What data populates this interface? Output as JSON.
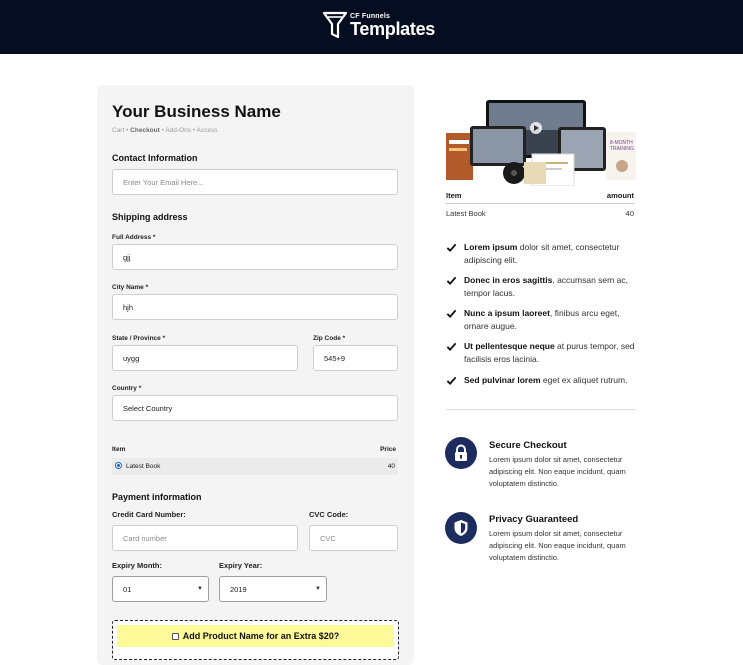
{
  "header": {
    "logo_small": "CF Funnels",
    "logo_big": "Templates"
  },
  "checkout": {
    "business_name": "Your Business Name",
    "breadcrumb": {
      "cart": "Cart",
      "sep1": " • ",
      "checkout": "Checkout",
      "sep2": " • ",
      "addons": "Add-Ons",
      "sep3": " • ",
      "access": "Access"
    },
    "contact_heading": "Contact Information",
    "email_placeholder": "Enter Your Email Here...",
    "shipping_heading": "Shipping address",
    "full_address_label": "Full Address *",
    "full_address_value": "gjj",
    "city_label": "City Name *",
    "city_value": "hjh",
    "state_label": "State / Province *",
    "state_value": "uygg",
    "zip_label": "Zip Code *",
    "zip_value": "545+9",
    "country_label": "Country *",
    "country_selected": "Select Country",
    "items_table": {
      "col_item": "Item",
      "col_price": "Price",
      "rows": [
        {
          "name": "Latest Book",
          "price": "40",
          "selected": true
        }
      ]
    },
    "payment_heading": "Payment information",
    "cc_label": "Credit Card Number:",
    "cc_placeholder": "Card number",
    "cvc_label": "CVC Code:",
    "cvc_placeholder": "CVC",
    "exp_month_label": "Expiry Month:",
    "exp_month_value": "01",
    "exp_year_label": "Expiry Year:",
    "exp_year_value": "2019",
    "order_bump_label": "Add Product Name for an Extra $20?"
  },
  "summary": {
    "col_item": "Item",
    "col_amount": "amount",
    "rows": [
      {
        "name": "Latest Book",
        "amount": "40"
      }
    ]
  },
  "bullets": [
    {
      "bold": "Lorem ipsum",
      "rest": " dolor sit amet, consectetur adipiscing elit."
    },
    {
      "bold": "Donec in eros sagittis",
      "rest": ", accumsan sem ac, tempor lacus."
    },
    {
      "bold": "Nunc a ipsum laoreet",
      "rest": ", finibus arcu eget, ornare augue."
    },
    {
      "bold": "Ut pellentesque neque",
      "rest": " at purus tempor, sed facilisis eros lacinia."
    },
    {
      "bold": "Sed pulvinar lorem",
      "rest": " eget ex aliquet rutrum."
    }
  ],
  "badges": [
    {
      "title": "Secure Checkout",
      "icon": "lock-icon",
      "text": "Lorem ipsum dolor sit amet, consectetur adipiscing elit. Non eaque incidunt, quam voluptatem distinctio."
    },
    {
      "title": "Privacy Guaranteed",
      "icon": "shield-icon",
      "text": "Lorem ipsum dolor sit amet, consectetur adipiscing elit. Non eaque incidunt, quam voluptatem distinctio."
    }
  ],
  "colors": {
    "header_bg": "#050d20",
    "badge_bg": "#1c2c5e",
    "bump_highlight": "#fff99a",
    "radio": "#1565c0"
  }
}
